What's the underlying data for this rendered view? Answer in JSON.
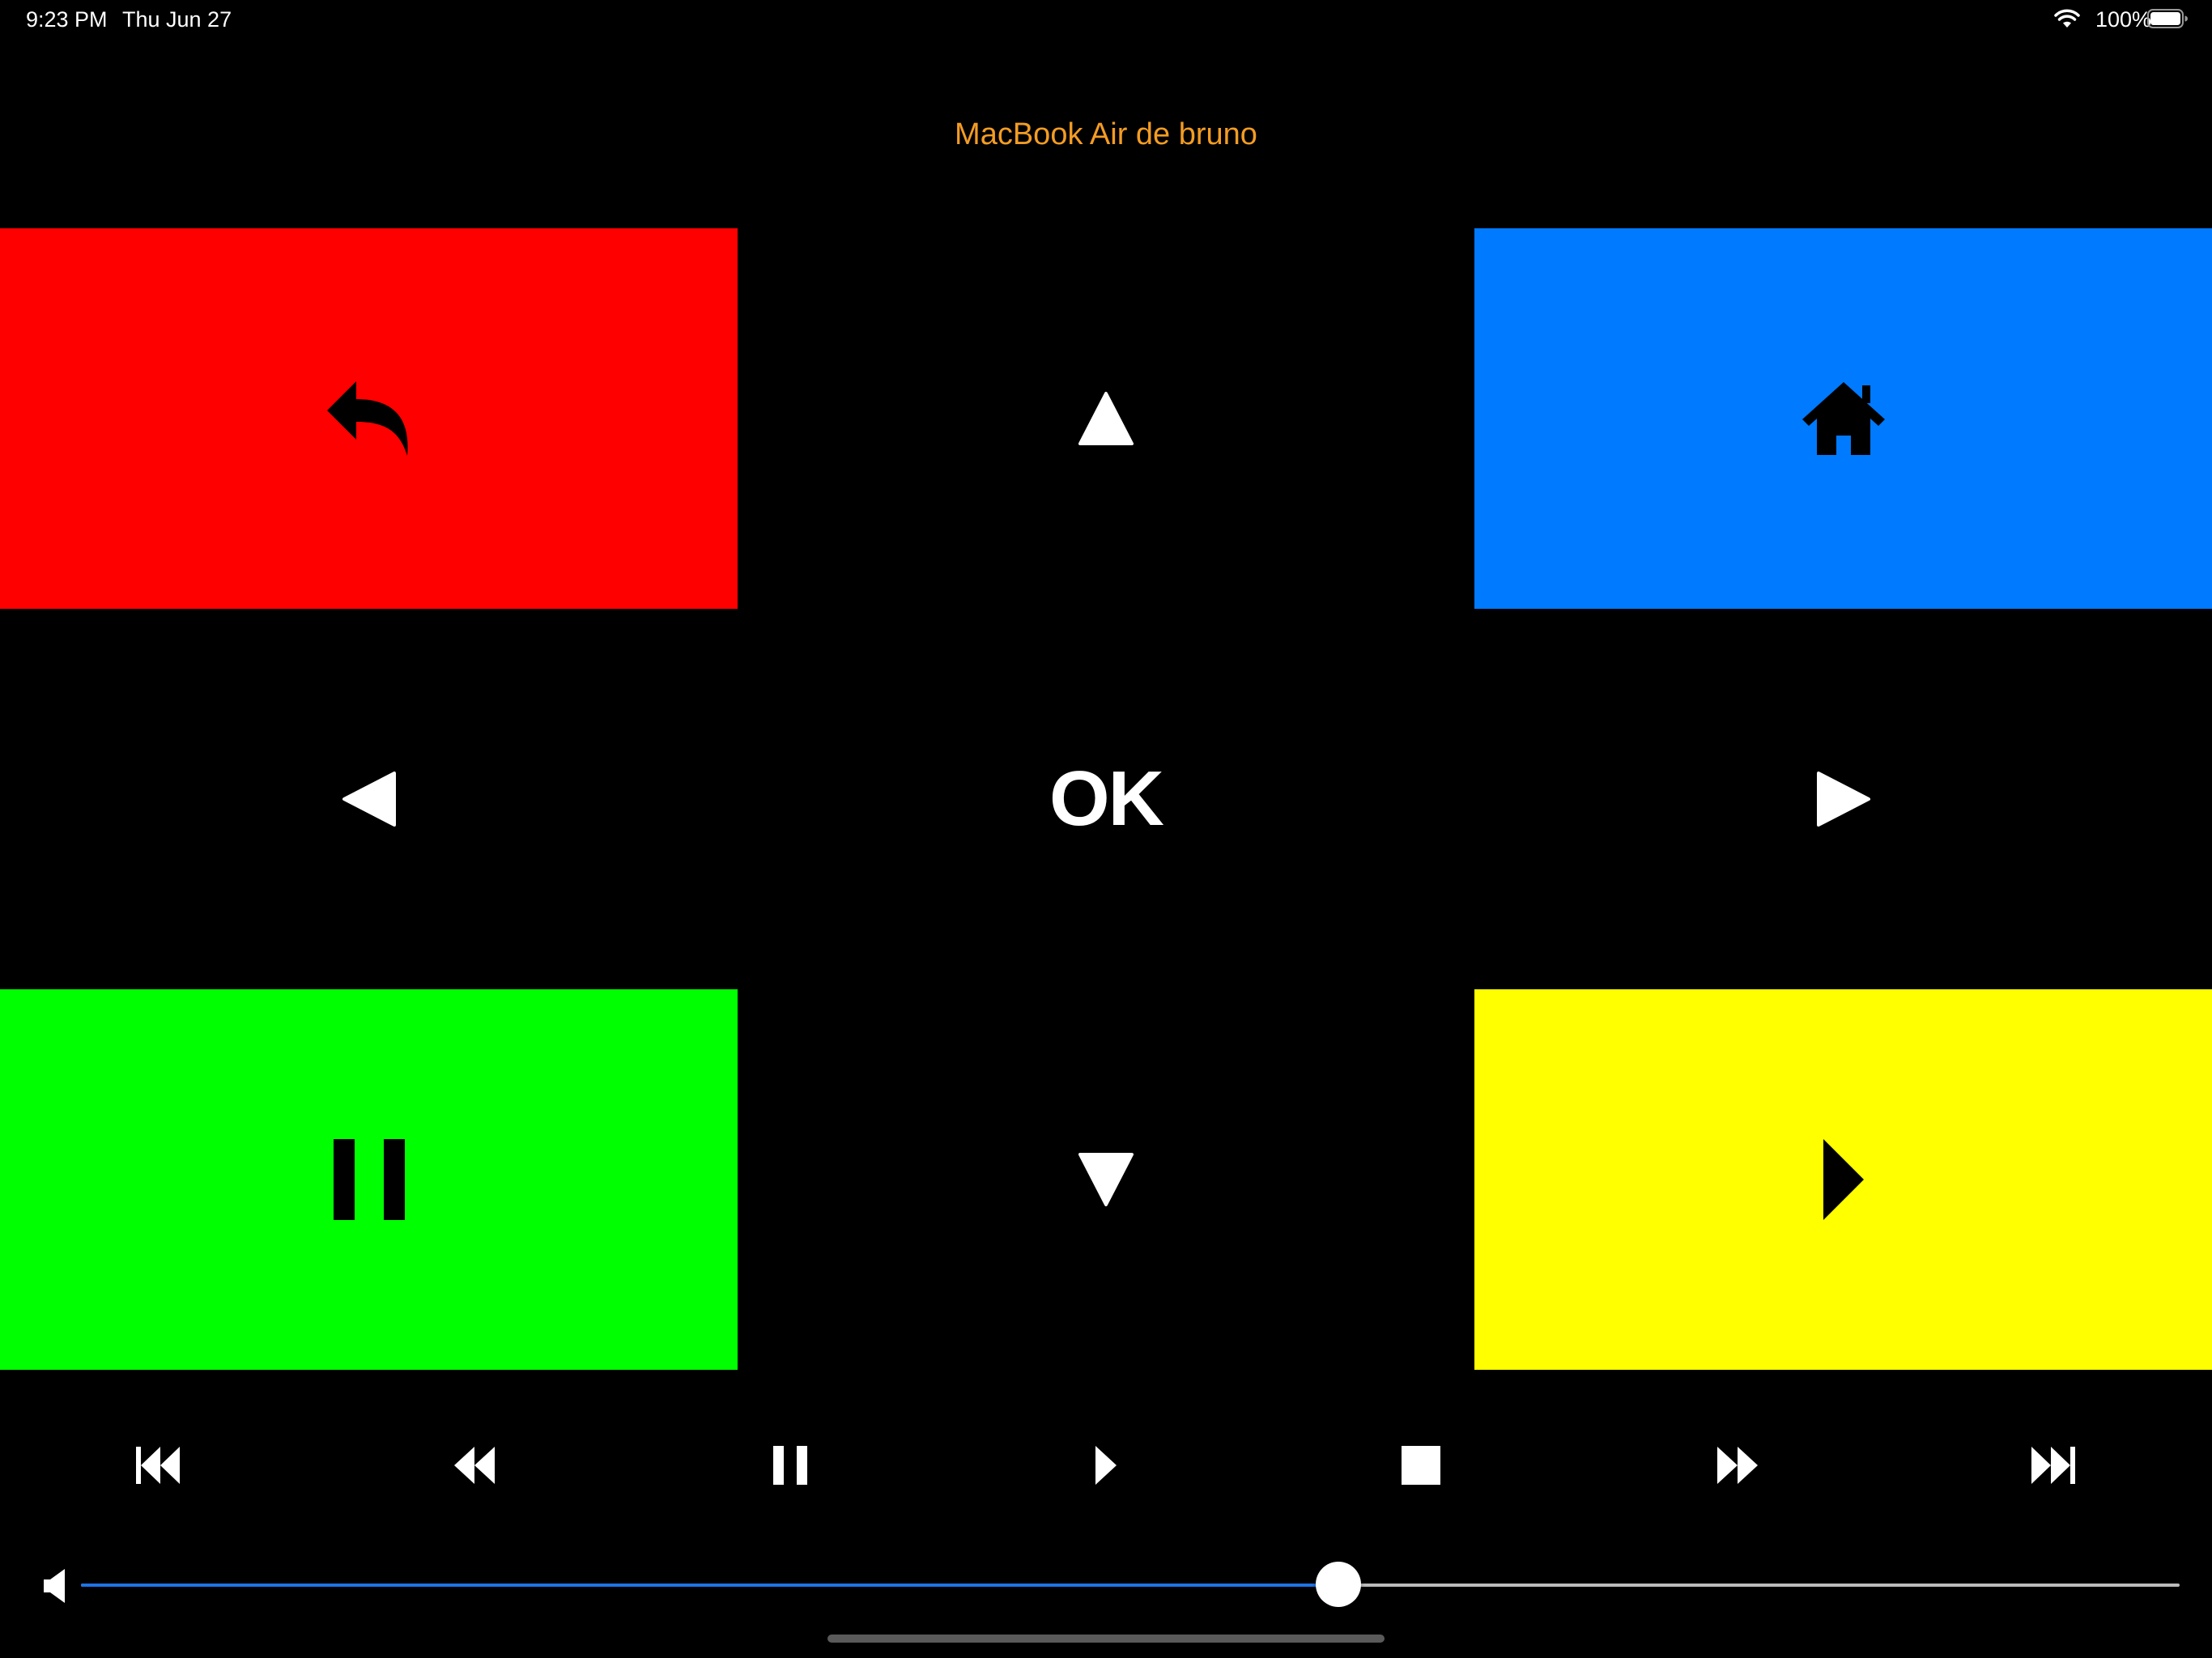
{
  "status_bar": {
    "time": "9:23 PM",
    "date": "Thu Jun 27",
    "battery_percent": "100%",
    "icons": [
      "wifi-icon",
      "battery-icon"
    ]
  },
  "header": {
    "title": "MacBook Air de bruno"
  },
  "remote": {
    "back": {
      "icon": "back-arrow-icon",
      "color": "#FF0000"
    },
    "up": {
      "icon": "triangle-up-icon"
    },
    "home": {
      "icon": "house-icon",
      "color": "#007AFF"
    },
    "left": {
      "icon": "triangle-left-icon"
    },
    "ok": {
      "label": "OK"
    },
    "right": {
      "icon": "triangle-right-icon"
    },
    "pause": {
      "icon": "pause-icon",
      "color": "#00FF00"
    },
    "down": {
      "icon": "triangle-down-icon"
    },
    "play": {
      "icon": "play-icon",
      "color": "#FFFF00"
    }
  },
  "transport": [
    {
      "name": "skip-to-start",
      "icon": "skip-back-icon"
    },
    {
      "name": "rewind",
      "icon": "rewind-icon"
    },
    {
      "name": "pause",
      "icon": "pause-small-icon"
    },
    {
      "name": "play",
      "icon": "play-small-icon"
    },
    {
      "name": "stop",
      "icon": "stop-icon"
    },
    {
      "name": "fast-forward",
      "icon": "fast-forward-icon"
    },
    {
      "name": "skip-to-end",
      "icon": "skip-forward-icon"
    }
  ],
  "volume": {
    "icon": "speaker-icon",
    "level": 0.599,
    "fill_color": "#1E73E6",
    "track_color": "#BBBBBB"
  }
}
